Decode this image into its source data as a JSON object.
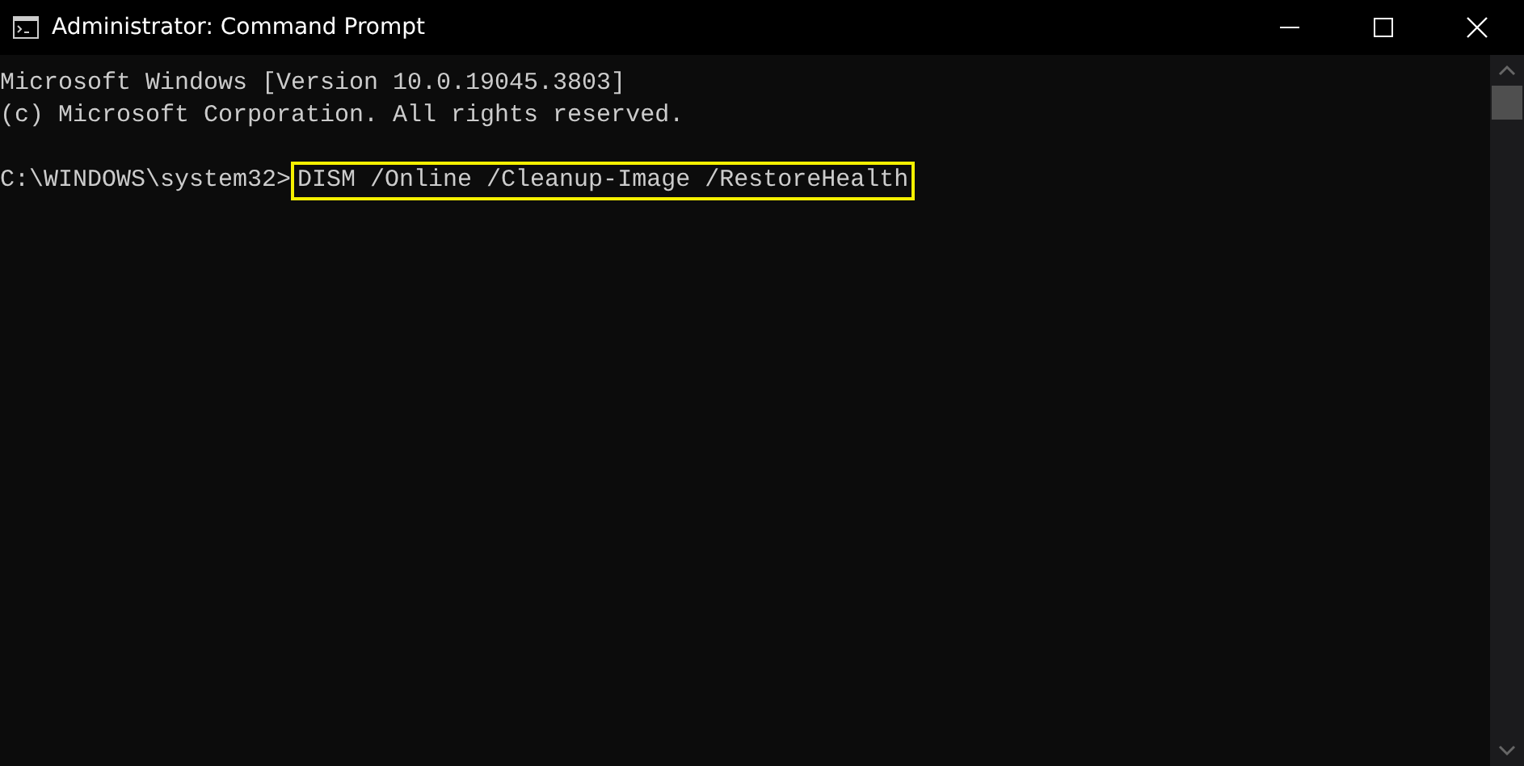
{
  "window": {
    "title": "Administrator: Command Prompt"
  },
  "console": {
    "lines": [
      {
        "kind": "text",
        "text": "Microsoft Windows [Version 10.0.19045.3803]"
      },
      {
        "kind": "text",
        "text": "(c) Microsoft Corporation. All rights reserved."
      },
      {
        "kind": "blank"
      },
      {
        "kind": "prompt",
        "prompt": "C:\\WINDOWS\\system32>",
        "command": "DISM /Online /Cleanup-Image /RestoreHealth",
        "highlighted": true
      }
    ]
  }
}
